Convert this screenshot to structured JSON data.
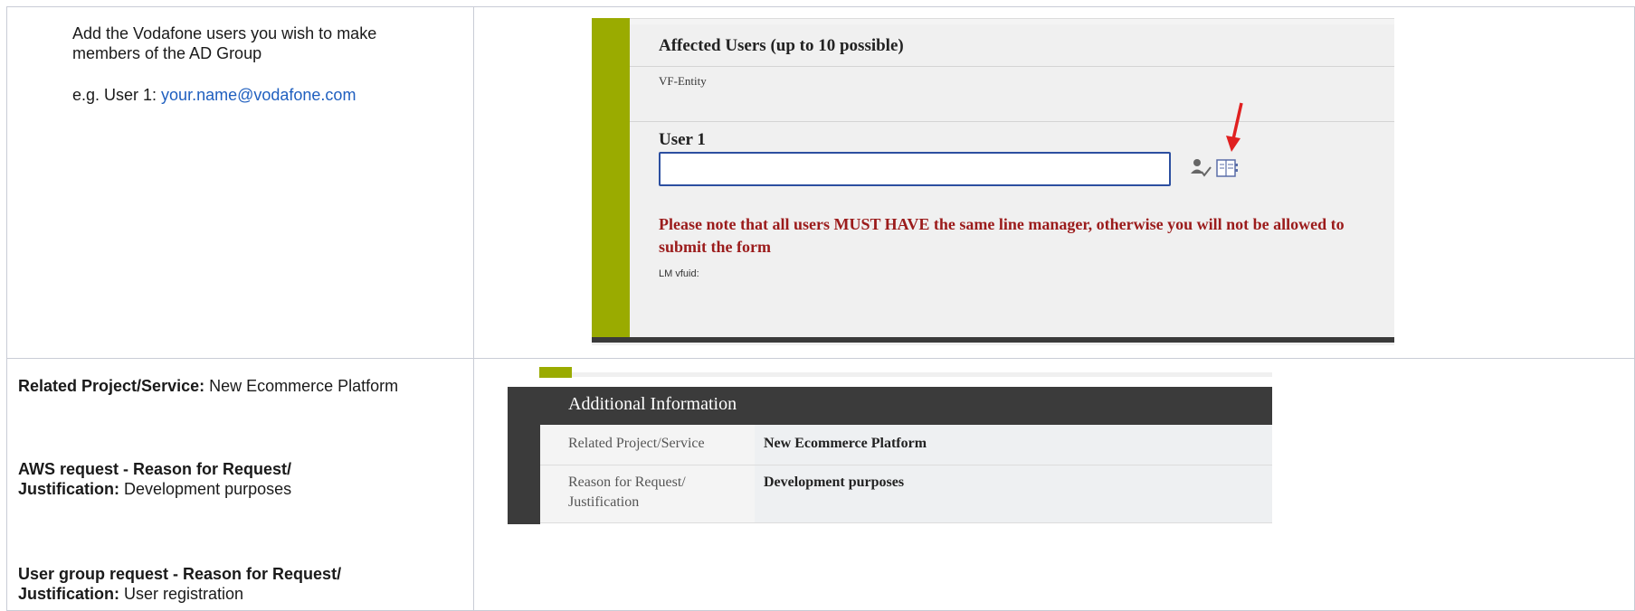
{
  "row1": {
    "instruction_line1": "Add the Vodafone users you wish to make",
    "instruction_line2": "members of the AD Group",
    "example_prefix": "e.g. User 1: ",
    "example_email": "your.name@vodafone.com"
  },
  "form_shot": {
    "section_title": "Affected Users  (up to 10 possible)",
    "entity_label": "VF-Entity",
    "user1_label": "User 1",
    "user1_value": "",
    "warning": "Please note that all users MUST HAVE the same line manager, otherwise you will not be allowed to submit the form",
    "lm_label": "LM vfuid:",
    "colors": {
      "accent_bar": "#9aab00",
      "input_border": "#2c4fa0",
      "warning_text": "#9b1b1b",
      "arrow": "#e02020"
    },
    "icons": [
      "people-check-icon",
      "address-book-icon",
      "red-arrow-pointer-icon"
    ]
  },
  "row2": {
    "project_label": "Related Project/Service:",
    "project_value": " New Ecommerce Platform",
    "aws_label_line1": "AWS request - Reason for Request/",
    "aws_label_line2": "Justification:",
    "aws_value": " Development purposes",
    "usergroup_label_line1": "User group request - Reason for Request/",
    "usergroup_label_line2": "Justification:",
    "usergroup_value": " User registration"
  },
  "info_shot": {
    "header": "Additional Information",
    "rows": [
      {
        "label_line1": "Related Project/Service",
        "label_line2": "",
        "value": "New Ecommerce Platform"
      },
      {
        "label_line1": "Reason for Request/",
        "label_line2": "Justification",
        "value": "Development purposes"
      }
    ]
  }
}
